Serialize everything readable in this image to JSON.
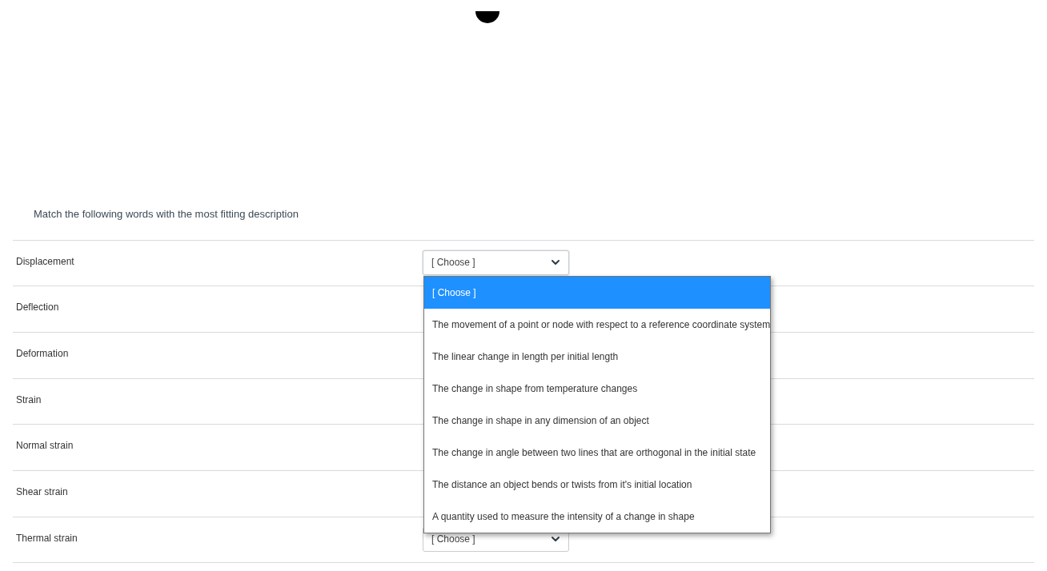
{
  "question": "Match the following words with the most fitting description",
  "rows": [
    {
      "term": "Displacement",
      "select": {
        "value": "[ Choose ]",
        "expanded": true,
        "options": [
          {
            "label": "[ Choose ]",
            "selected": true
          },
          {
            "label": "The movement of a point or node with respect to a reference coordinate system",
            "selected": false
          },
          {
            "label": "The linear change in length per initial length",
            "selected": false
          },
          {
            "label": "The change in shape from temperature changes",
            "selected": false
          },
          {
            "label": "The change in shape in any dimension of an object",
            "selected": false
          },
          {
            "label": "The change in angle between two lines that are orthogonal in the initial state",
            "selected": false
          },
          {
            "label": "The distance an object bends or twists from it's initial location",
            "selected": false
          },
          {
            "label": "A quantity used to measure the intensity of a change in shape",
            "selected": false
          }
        ]
      }
    },
    {
      "term": "Deflection"
    },
    {
      "term": "Deformation"
    },
    {
      "term": "Strain"
    },
    {
      "term": "Normal strain"
    },
    {
      "term": "Shear strain"
    },
    {
      "term": "Thermal strain",
      "select": {
        "value": "[ Choose ]",
        "expanded": false
      }
    }
  ]
}
